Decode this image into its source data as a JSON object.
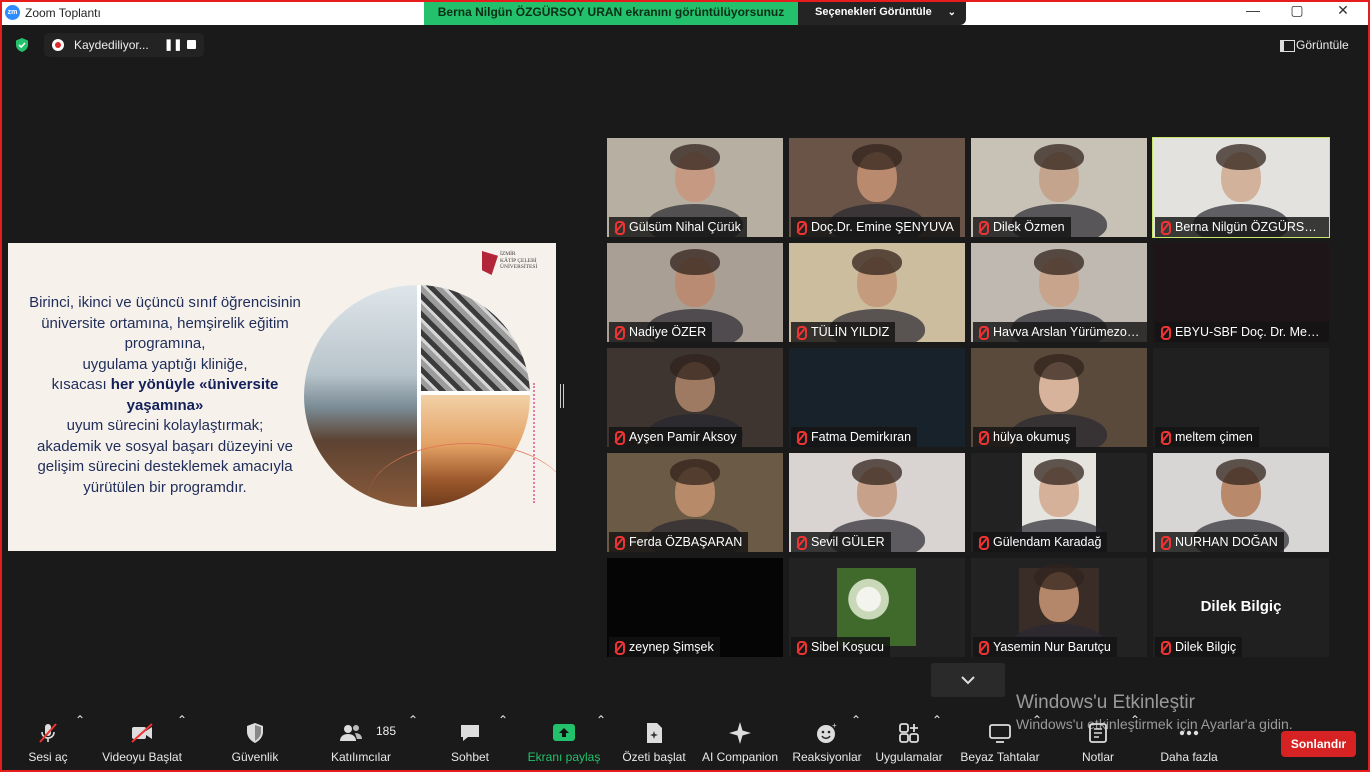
{
  "window": {
    "title": "Zoom Toplantı",
    "share_banner": "Berna Nilgün ÖZGÜRSOY URAN ekranını görüntülüyorsunuz",
    "options_label": "Seçenekleri Görüntüle",
    "controls": [
      "—",
      "▢",
      "✕"
    ]
  },
  "topbar": {
    "recording_label": "Kaydediliyor...",
    "pause_glyph": "❚❚",
    "view_label": "Görüntüle"
  },
  "slide": {
    "logo_text": "İZMİR\nKÂTİP ÇELEBİ\nÜNİVERSİTESİ",
    "line1": "Birinci, ikinci ve üçüncü sınıf öğrencisinin",
    "line2": "üniversite ortamına, hemşirelik eğitim programına,",
    "line3": "uygulama yaptığı kliniğe,",
    "line4_prefix": "kısacası ",
    "line4_bold": "her yönüyle «üniversite yaşamına»",
    "line5": "uyum sürecini kolaylaştırmak;",
    "line6": "akademik ve sosyal başarı düzeyini ve gelişim sürecini desteklemek amacıyla",
    "line7": "yürütülen bir programdır."
  },
  "participants": [
    {
      "name": "Gülsüm Nihal Çürük",
      "bg": "#b7b0a2",
      "skin": "#c69a82"
    },
    {
      "name": "Doç.Dr. Emine ŞENYUVA",
      "bg": "#6a5447",
      "skin": "#b98a6d"
    },
    {
      "name": "Dilek Özmen",
      "bg": "#c8c1b6",
      "skin": "#c4a48c"
    },
    {
      "name": "Berna Nilgün ÖZGÜRSOY URAN",
      "bg": "#e3e2de",
      "skin": "#d2b29b"
    },
    {
      "name": "Nadiye ÖZER",
      "bg": "#aa9f94",
      "skin": "#b98b72"
    },
    {
      "name": "TÜLİN YILDIZ",
      "bg": "#cdbd9f",
      "skin": "#c49b7c"
    },
    {
      "name": "Havva Arslan Yürümezoğlu",
      "bg": "#bfb9b1",
      "skin": "#c9a48c"
    },
    {
      "name": "EBYU-SBF Doç. Dr. Meryem",
      "bg": "#1d1518",
      "skin": ""
    },
    {
      "name": "Ayşen Pamir Aksoy",
      "bg": "#3e3530",
      "skin": "#9f7a62"
    },
    {
      "name": "Fatma Demirkıran",
      "bg": "#17222a",
      "skin": ""
    },
    {
      "name": "hülya okumuş",
      "bg": "#5a4a3c",
      "skin": "#d6b39a"
    },
    {
      "name": "meltem çimen",
      "bg": "#202020",
      "skin": ""
    },
    {
      "name": "Ferda ÖZBAŞARAN",
      "bg": "#6b5a45",
      "skin": "#b78a6a"
    },
    {
      "name": "Sevil GÜLER",
      "bg": "#d9d3d1",
      "skin": "#c8a18b"
    },
    {
      "name": "Gülendam Karadağ",
      "bg": "#222222",
      "skin": "#d6b19a"
    },
    {
      "name": "NURHAN DOĞAN",
      "bg": "#d8d6d4",
      "skin": "#b9896c"
    },
    {
      "name": "zeynep Şimşek",
      "bg": "#050505",
      "skin": ""
    },
    {
      "name": "Sibel Koşucu",
      "bg": "#222222",
      "skin": ""
    },
    {
      "name": "Yasemin Nur Barutçu",
      "bg": "#222222",
      "skin": "#b5876a"
    },
    {
      "name": "Dilek Bilgiç",
      "bg": "#202020",
      "skin": "",
      "center": "Dilek Bilgiç"
    }
  ],
  "watermark": {
    "line1": "Windows'u Etkinleştir",
    "line2": "Windows'u etkinleştirmek için Ayarlar'a gidin."
  },
  "toolbar": {
    "unmute": "Sesi aç",
    "start_video": "Videoyu Başlat",
    "security": "Güvenlik",
    "participants": "Katılımcılar",
    "participants_count": "185",
    "chat": "Sohbet",
    "share": "Ekranı paylaş",
    "summary": "Özeti başlat",
    "ai": "AI Companion",
    "reactions": "Reaksiyonlar",
    "apps": "Uygulamalar",
    "whiteboard": "Beyaz Tahtalar",
    "notes": "Notlar",
    "more": "Daha fazla",
    "end": "Sonlandır",
    "share_color": "#23c16b",
    "end_color": "#d62222"
  }
}
